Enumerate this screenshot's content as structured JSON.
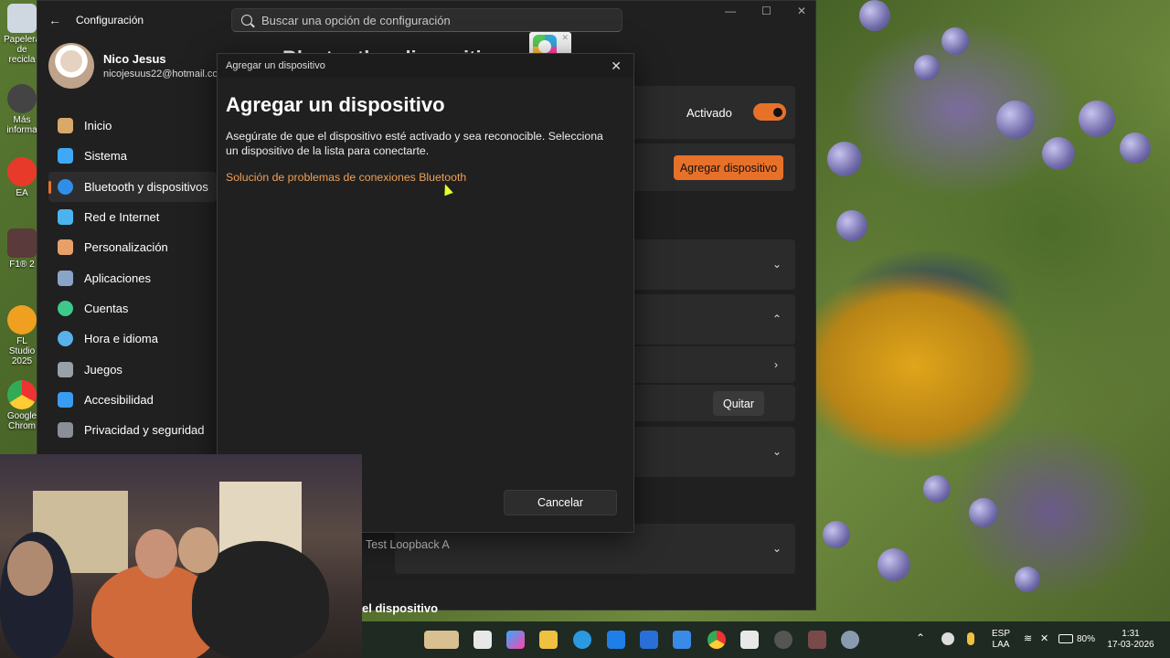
{
  "desktop": {
    "icons": [
      {
        "label": "Papelera de recicla",
        "name": "recycle-bin"
      },
      {
        "label": "Más informa",
        "name": "more-info"
      },
      {
        "label": "EA",
        "name": "ea-app"
      },
      {
        "label": "F1® 2",
        "name": "f1-game"
      },
      {
        "label": "FL Studio 2025",
        "name": "fl-studio"
      },
      {
        "label": "Google Chrom",
        "name": "google-chrome"
      }
    ]
  },
  "settings": {
    "title": "Configuración",
    "search_placeholder": "Buscar una opción de configuración",
    "user": {
      "name": "Nico Jesus",
      "email": "nicojesuus22@hotmail.com"
    },
    "nav": [
      {
        "label": "Inicio",
        "icon": "home-icon",
        "color": "#d9a86a"
      },
      {
        "label": "Sistema",
        "icon": "system-icon",
        "color": "#3fa9f5"
      },
      {
        "label": "Bluetooth y dispositivos",
        "icon": "bluetooth-icon",
        "color": "#2f8fe8",
        "active": true
      },
      {
        "label": "Red e Internet",
        "icon": "wifi-icon",
        "color": "#4bb4f0"
      },
      {
        "label": "Personalización",
        "icon": "brush-icon",
        "color": "#e8a06a"
      },
      {
        "label": "Aplicaciones",
        "icon": "apps-icon",
        "color": "#8aa4c8"
      },
      {
        "label": "Cuentas",
        "icon": "account-icon",
        "color": "#3cc98a"
      },
      {
        "label": "Hora e idioma",
        "icon": "clock-icon",
        "color": "#5ab0e8"
      },
      {
        "label": "Juegos",
        "icon": "gamepad-icon",
        "color": "#9aa0a8"
      },
      {
        "label": "Accesibilidad",
        "icon": "accessibility-icon",
        "color": "#3a9cf0"
      },
      {
        "label": "Privacidad y seguridad",
        "icon": "shield-icon",
        "color": "#8a8e96"
      }
    ],
    "page_title": "Bluetooth y dispositivos",
    "bluetooth_state": "Activado",
    "add_device_label": "Agregar dispositivo",
    "remove_label": "Quitar",
    "device_name": "Test Loopback A",
    "bottom_section": "el dispositivo"
  },
  "dialog": {
    "window_title": "Agregar un dispositivo",
    "heading": "Agregar un dispositivo",
    "description": "Asegúrate de que el dispositivo esté activado y sea reconocible. Selecciona un dispositivo de la lista para conectarte.",
    "troubleshoot_link": "Solución de problemas de conexiones Bluetooth",
    "cancel_label": "Cancelar"
  },
  "taskbar": {
    "language": "ESP",
    "layout": "LAA",
    "battery": "80%",
    "time": "1:31",
    "date": "17-03-2026"
  },
  "colors": {
    "accent": "#e8712a",
    "link": "#f0a05a"
  }
}
